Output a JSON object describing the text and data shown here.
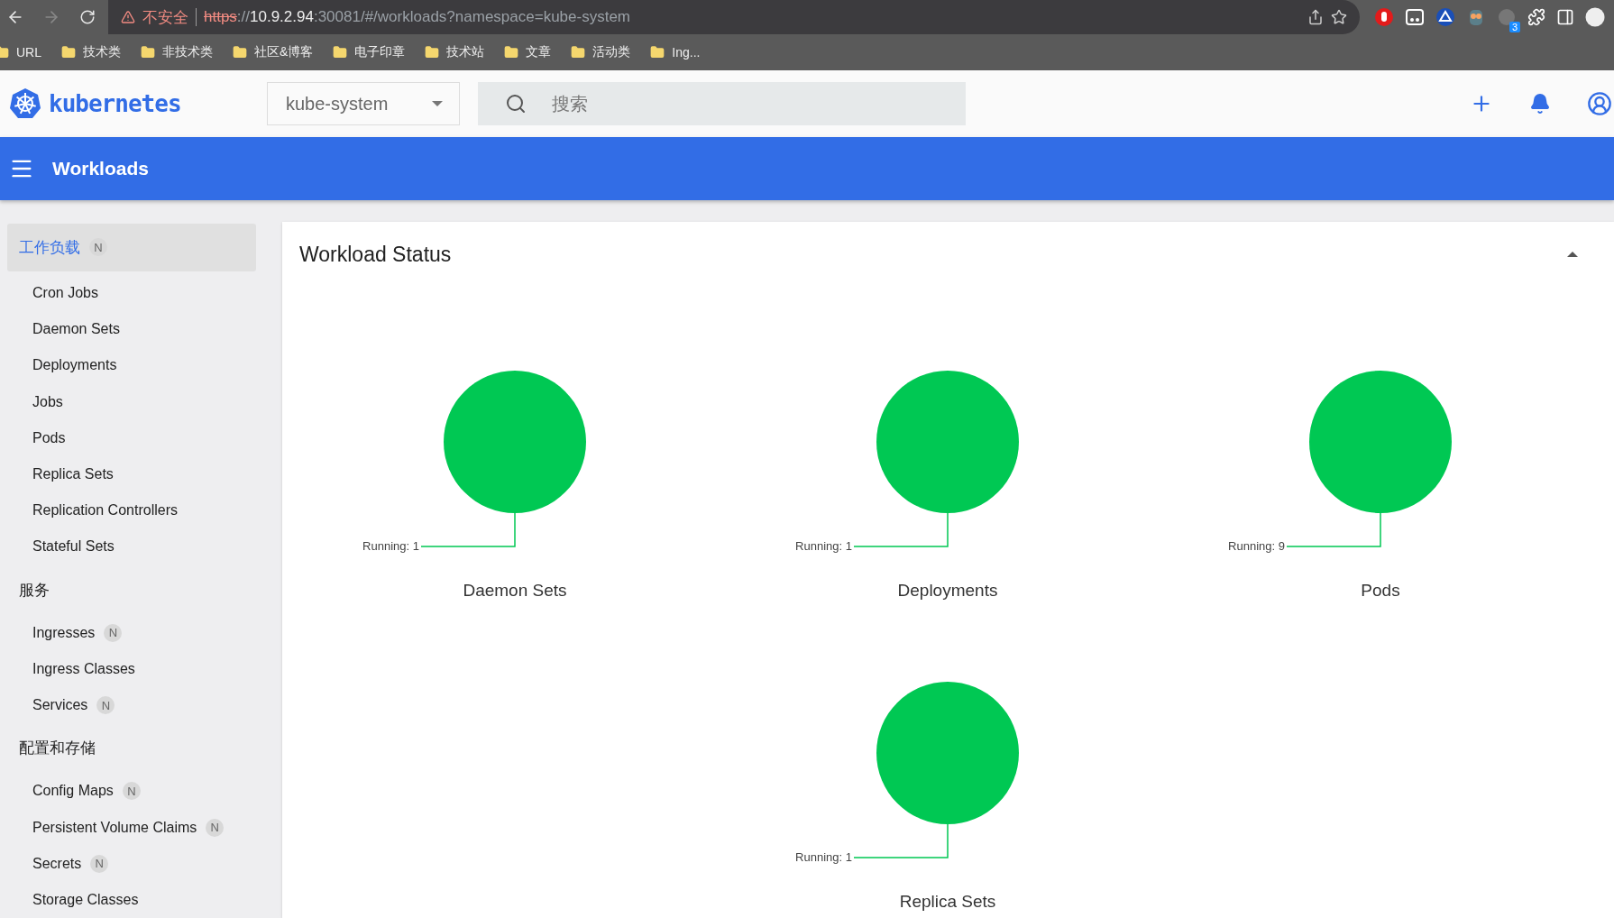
{
  "browser": {
    "security": "不安全",
    "url": {
      "scheme": "https",
      "separator": "://",
      "host": "10.9.2.94",
      "path": ":30081/#/workloads?namespace=kube-system"
    },
    "extension_badge": "3",
    "bookmarks": [
      "URL",
      "技术类",
      "非技术类",
      "社区&博客",
      "电子印章",
      "技术站",
      "文章",
      "活动类",
      "Ing..."
    ]
  },
  "header": {
    "brand": "kubernetes",
    "namespace": "kube-system",
    "search": {
      "placeholder": "搜索"
    }
  },
  "toolbar": {
    "title": "Workloads"
  },
  "sidebar": {
    "sections": [
      {
        "title": "工作负载",
        "badge": "N",
        "selected": true,
        "items": [
          {
            "label": "Cron Jobs",
            "selected": false
          },
          {
            "label": "Daemon Sets",
            "selected": false
          },
          {
            "label": "Deployments",
            "selected": false
          },
          {
            "label": "Jobs",
            "selected": false
          },
          {
            "label": "Pods",
            "selected": false
          },
          {
            "label": "Replica Sets",
            "selected": false
          },
          {
            "label": "Replication Controllers",
            "selected": false
          },
          {
            "label": "Stateful Sets",
            "selected": false
          }
        ]
      },
      {
        "title": "服务",
        "selected": false,
        "items": [
          {
            "label": "Ingresses",
            "badge": "N",
            "selected": false
          },
          {
            "label": "Ingress Classes",
            "selected": false
          },
          {
            "label": "Services",
            "badge": "N",
            "selected": false
          }
        ]
      },
      {
        "title": "配置和存储",
        "selected": false,
        "items": [
          {
            "label": "Config Maps",
            "badge": "N",
            "selected": false
          },
          {
            "label": "Persistent Volume Claims",
            "badge": "N",
            "selected": false
          },
          {
            "label": "Secrets",
            "badge": "N",
            "selected": false
          },
          {
            "label": "Storage Classes",
            "selected": false
          }
        ]
      }
    ]
  },
  "card": {
    "title": "Workload Status",
    "expanded": true,
    "charts": [
      {
        "title": "Daemon Sets",
        "label": "Running: 1"
      },
      {
        "title": "Deployments",
        "label": "Running: 1"
      },
      {
        "title": "Pods",
        "label": "Running: 9"
      },
      {
        "title": "Replica Sets",
        "label": "Running: 1"
      }
    ]
  }
}
